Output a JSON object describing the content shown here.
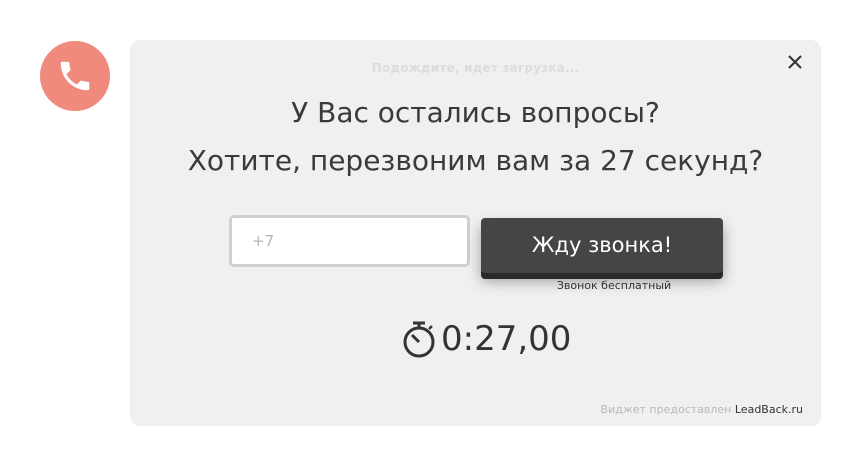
{
  "widget": {
    "loading_text": "Подождите, идет загрузка...",
    "headline_line1": "У Вас остались вопросы?",
    "headline_line2": "Хотите, перезвоним вам за 27 секунд?",
    "phone_placeholder": "+7",
    "phone_value": "",
    "cta_label": "Жду звонка!",
    "cta_note": "Звонок бесплатный",
    "timer_value": "0:27,00",
    "credit_text": "Виджет предоставлен",
    "credit_link": "LeadBack.ru"
  },
  "icons": {
    "call_button": "phone-icon",
    "close": "close-icon",
    "timer": "stopwatch-icon"
  },
  "colors": {
    "call_button_bg": "#ef8a7c",
    "panel_bg": "#f0f0f0",
    "cta_bg": "#454545",
    "text": "#3a3a3a"
  }
}
